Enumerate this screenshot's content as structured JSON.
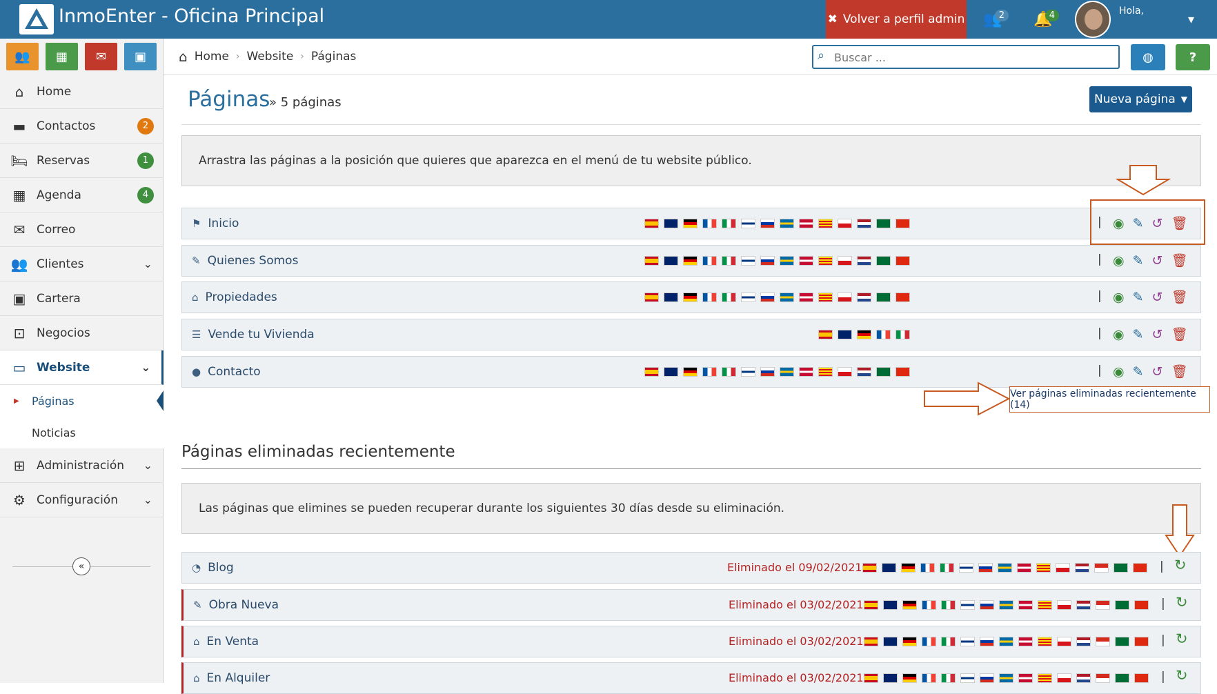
{
  "app": {
    "title": "InmoEnter - Oficina Principal"
  },
  "topbar": {
    "admin_label": "Volver a perfil admin",
    "users_badge": "2",
    "bell_badge": "4",
    "user_greeting": "Hola,"
  },
  "sidebar": {
    "items": [
      {
        "label": "Home"
      },
      {
        "label": "Contactos",
        "badge": "2"
      },
      {
        "label": "Reservas",
        "badge": "1"
      },
      {
        "label": "Agenda",
        "badge": "4"
      },
      {
        "label": "Correo"
      },
      {
        "label": "Clientes"
      },
      {
        "label": "Cartera"
      },
      {
        "label": "Negocios"
      },
      {
        "label": "Website"
      },
      {
        "label": "Administración"
      },
      {
        "label": "Configuración"
      }
    ],
    "sub": [
      {
        "label": "Páginas"
      },
      {
        "label": "Noticias"
      }
    ]
  },
  "breadcrumb": {
    "home": "Home",
    "website": "Website",
    "current": "Páginas"
  },
  "search": {
    "placeholder": "Buscar ..."
  },
  "page": {
    "title": "Páginas",
    "subtitle": "» 5 páginas",
    "new_button": "Nueva página"
  },
  "info1": "Arrastra las páginas a la posición que quieres que aparezca en el menú de tu website público.",
  "pages": [
    {
      "name": "Inicio",
      "icon": "flag-icon"
    },
    {
      "name": "Quienes Somos",
      "icon": "edit-icon"
    },
    {
      "name": "Propiedades",
      "icon": "home-icon"
    },
    {
      "name": "Vende tu Vivienda",
      "icon": "list-icon"
    },
    {
      "name": "Contacto",
      "icon": "user-icon"
    }
  ],
  "tooltip": "Ver páginas eliminadas recientemente (14)",
  "deleted_section": {
    "title": "Páginas eliminadas recientemente",
    "info": "Las páginas que elimines se pueden recuperar durante los siguientes 30 días desde su eliminación."
  },
  "deleted_pages": [
    {
      "name": "Blog",
      "date": "Eliminado el 09/02/2021"
    },
    {
      "name": "Obra Nueva",
      "date": "Eliminado el 03/02/2021"
    },
    {
      "name": "En Venta",
      "date": "Eliminado el 03/02/2021"
    },
    {
      "name": "En Alquiler",
      "date": "Eliminado el 03/02/2021"
    }
  ]
}
